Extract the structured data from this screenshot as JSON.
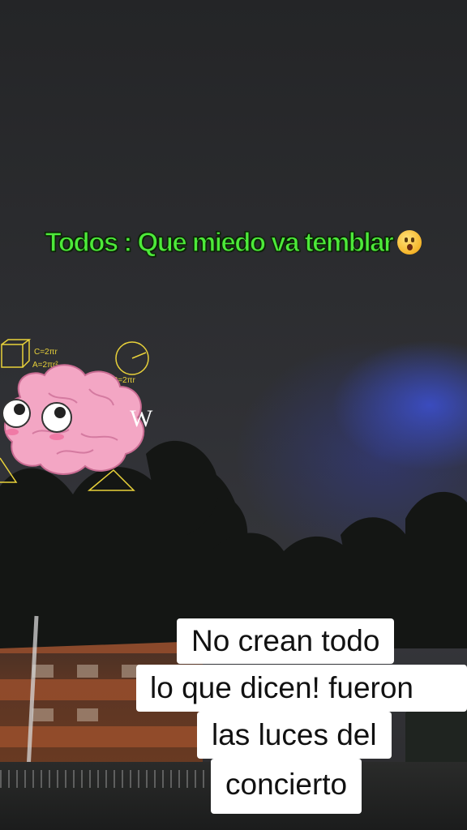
{
  "overlay": {
    "top_caption": "Todos : Que miedo va temblar",
    "emoji": "astonished-face-emoji",
    "caption_color": "#4dea3a",
    "watermark_letter": "W"
  },
  "subtitle": {
    "lines": [
      "No crean todo",
      "lo que dicen! fueron",
      "las luces del",
      "concierto"
    ]
  },
  "sticker": {
    "name": "pink-brain-thinking-sticker",
    "formulas": [
      "C=2πr",
      "A=2πr²",
      "C=2πr"
    ]
  },
  "scene": {
    "description_colors": {
      "sky": "#2c2d30",
      "blue_glow": "#3c50d2",
      "building": "#a0522d"
    }
  }
}
